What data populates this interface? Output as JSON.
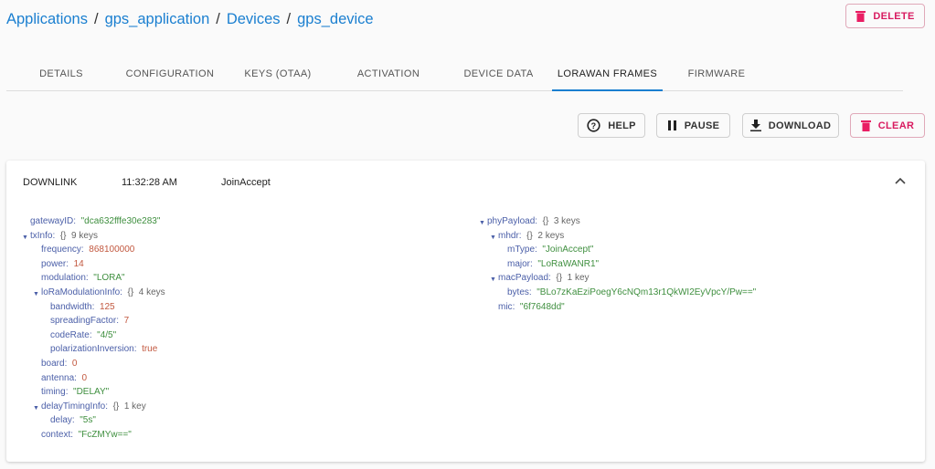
{
  "breadcrumb": [
    "Applications",
    "gps_application",
    "Devices",
    "gps_device"
  ],
  "delete_label": "DELETE",
  "tabs": [
    "DETAILS",
    "CONFIGURATION",
    "KEYS (OTAA)",
    "ACTIVATION",
    "DEVICE DATA",
    "LORAWAN FRAMES",
    "FIRMWARE"
  ],
  "active_tab": "LORAWAN FRAMES",
  "toolbar": {
    "help": "HELP",
    "pause": "PAUSE",
    "download": "DOWNLOAD",
    "clear": "CLEAR"
  },
  "frame": {
    "direction": "DOWNLINK",
    "time": "11:32:28 AM",
    "type": "JoinAccept"
  },
  "tree_left": [
    {
      "lvl": 0,
      "k": "gatewayID",
      "v": "\"dca632fffe30e283\"",
      "t": "s"
    },
    {
      "lvl": 0,
      "k": "txInfo",
      "v": "{}  9 keys",
      "t": "m",
      "exp": true
    },
    {
      "lvl": 1,
      "k": "frequency",
      "v": "868100000",
      "t": "n"
    },
    {
      "lvl": 1,
      "k": "power",
      "v": "14",
      "t": "n"
    },
    {
      "lvl": 1,
      "k": "modulation",
      "v": "\"LORA\"",
      "t": "s"
    },
    {
      "lvl": 1,
      "k": "loRaModulationInfo",
      "v": "{}  4 keys",
      "t": "m",
      "exp": true
    },
    {
      "lvl": 2,
      "k": "bandwidth",
      "v": "125",
      "t": "n"
    },
    {
      "lvl": 2,
      "k": "spreadingFactor",
      "v": "7",
      "t": "n"
    },
    {
      "lvl": 2,
      "k": "codeRate",
      "v": "\"4/5\"",
      "t": "s"
    },
    {
      "lvl": 2,
      "k": "polarizationInversion",
      "v": "true",
      "t": "n"
    },
    {
      "lvl": 1,
      "k": "board",
      "v": "0",
      "t": "n"
    },
    {
      "lvl": 1,
      "k": "antenna",
      "v": "0",
      "t": "n"
    },
    {
      "lvl": 1,
      "k": "timing",
      "v": "\"DELAY\"",
      "t": "s"
    },
    {
      "lvl": 1,
      "k": "delayTimingInfo",
      "v": "{}  1 key",
      "t": "m",
      "exp": true
    },
    {
      "lvl": 2,
      "k": "delay",
      "v": "\"5s\"",
      "t": "s"
    },
    {
      "lvl": 1,
      "k": "context",
      "v": "\"FcZMYw==\"",
      "t": "s"
    }
  ],
  "tree_right": [
    {
      "lvl": 0,
      "k": "phyPayload",
      "v": "{}  3 keys",
      "t": "m",
      "exp": true
    },
    {
      "lvl": 1,
      "k": "mhdr",
      "v": "{}  2 keys",
      "t": "m",
      "exp": true
    },
    {
      "lvl": 2,
      "k": "mType",
      "v": "\"JoinAccept\"",
      "t": "s"
    },
    {
      "lvl": 2,
      "k": "major",
      "v": "\"LoRaWANR1\"",
      "t": "s"
    },
    {
      "lvl": 1,
      "k": "macPayload",
      "v": "{}  1 key",
      "t": "m",
      "exp": true
    },
    {
      "lvl": 2,
      "k": "bytes",
      "v": "\"BLo7zKaEziPoegY6cNQm13r1QkWI2EyVpcY/Pw==\"",
      "t": "s"
    },
    {
      "lvl": 1,
      "k": "mic",
      "v": "\"6f7648dd\"",
      "t": "s"
    }
  ]
}
